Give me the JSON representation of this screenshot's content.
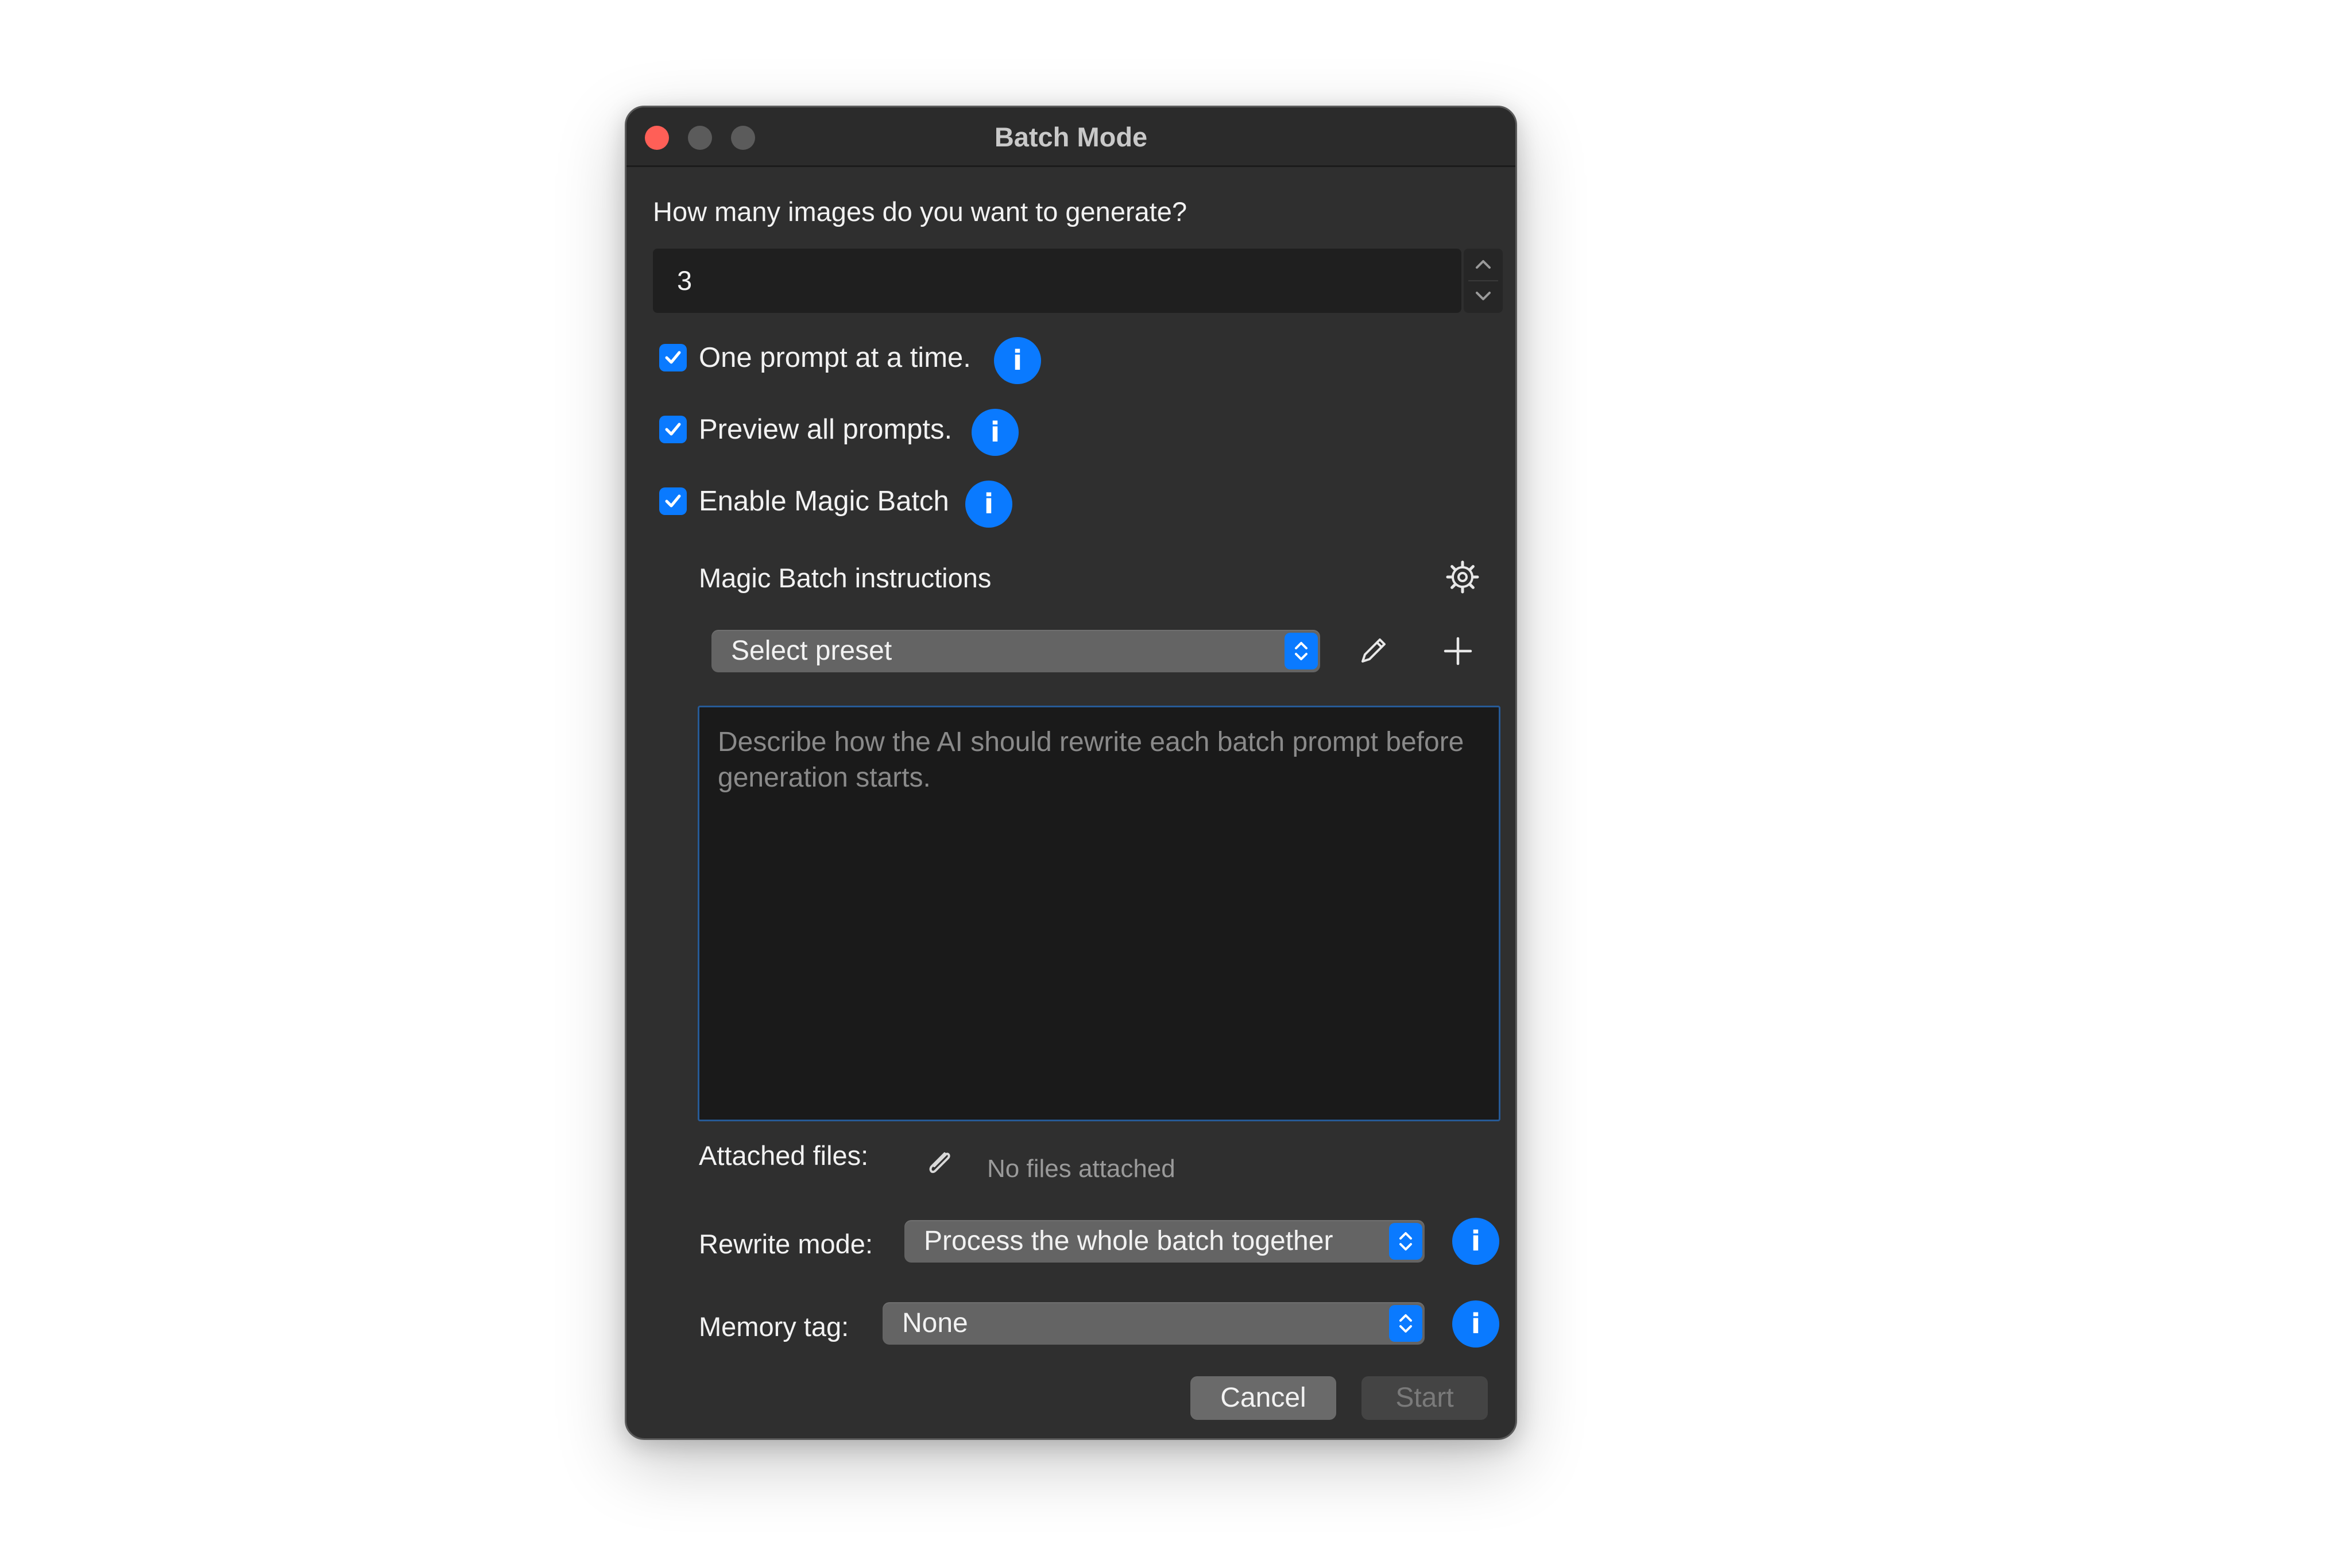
{
  "window": {
    "title": "Batch Mode"
  },
  "count": {
    "question": "How many images do you want to generate?",
    "value": "3"
  },
  "options": [
    {
      "label": "One prompt at a time.",
      "checked": true
    },
    {
      "label": "Preview all prompts.",
      "checked": true
    },
    {
      "label": "Enable Magic Batch",
      "checked": true
    }
  ],
  "info_glyph": "i",
  "magic": {
    "heading": "Magic Batch instructions",
    "preset": "Select preset",
    "instructions_placeholder": "Describe how the AI should rewrite each batch prompt before generation starts.",
    "attached_label": "Attached files:",
    "attached_status": "No files attached",
    "rewrite_label": "Rewrite mode:",
    "rewrite_value": "Process the whole batch together",
    "memory_label": "Memory tag:",
    "memory_value": "None"
  },
  "buttons": {
    "cancel": "Cancel",
    "start": "Start"
  },
  "icons": {
    "settings": "gear-icon",
    "edit": "pencil-icon",
    "add": "plus-icon",
    "attach": "paperclip-icon",
    "info": "info-icon"
  },
  "colors": {
    "accent": "#0a7aff",
    "window_bg": "#2f2f2f",
    "close": "#ff5f57"
  }
}
